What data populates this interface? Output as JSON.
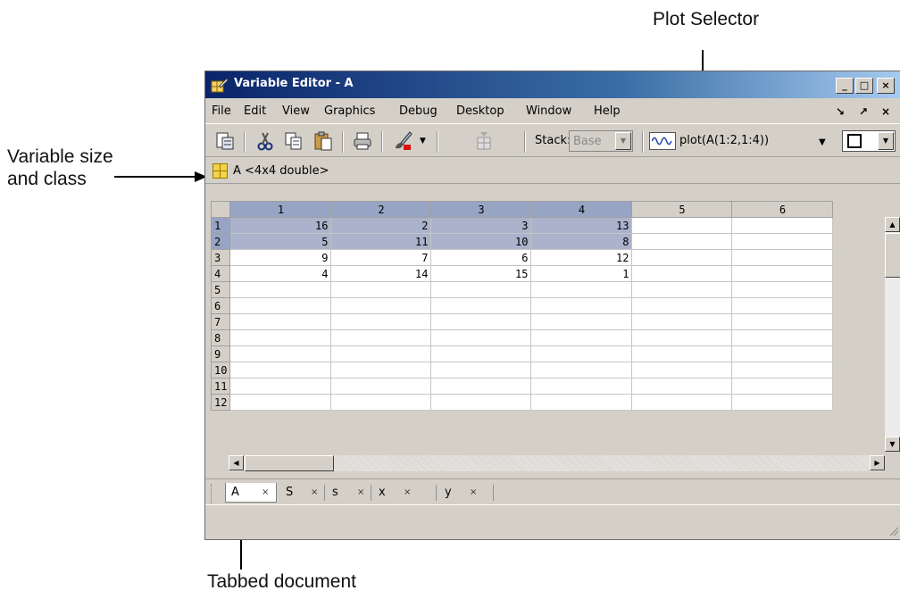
{
  "callouts": {
    "plot_selector": "Plot Selector",
    "variable_line1": "Variable size",
    "variable_line2": "and class",
    "tabbed_document": "Tabbed document"
  },
  "window": {
    "title": "Variable Editor - A",
    "controls": {
      "minimize": "_",
      "maximize": "□",
      "close": "×"
    }
  },
  "menu": {
    "items": [
      "File",
      "Edit",
      "View",
      "Graphics",
      "Debug",
      "Desktop",
      "Window",
      "Help"
    ],
    "dock": "↘",
    "undock": "↗",
    "close": "×"
  },
  "toolbar": {
    "icons": [
      "import-data-icon",
      "cut-icon",
      "copy-icon",
      "paste-icon",
      "print-icon",
      "brush-icon",
      "dropdown-arrow-icon",
      "variable-new-icon"
    ],
    "stack_label": "Stack:",
    "stack_value": "Base",
    "plot_command": "plot(A(1:2,1:4))"
  },
  "info": {
    "variable_summary": "A <4x4 double>"
  },
  "sheet": {
    "columns": [
      "1",
      "2",
      "3",
      "4",
      "5",
      "6"
    ],
    "rows": [
      {
        "label": "1",
        "cells": [
          "16",
          "2",
          "3",
          "13",
          "",
          ""
        ]
      },
      {
        "label": "2",
        "cells": [
          "5",
          "11",
          "10",
          "8",
          "",
          ""
        ]
      },
      {
        "label": "3",
        "cells": [
          "9",
          "7",
          "6",
          "12",
          "",
          ""
        ]
      },
      {
        "label": "4",
        "cells": [
          "4",
          "14",
          "15",
          "1",
          "",
          ""
        ]
      },
      {
        "label": "5",
        "cells": [
          "",
          "",
          "",
          "",
          "",
          ""
        ]
      },
      {
        "label": "6",
        "cells": [
          "",
          "",
          "",
          "",
          "",
          ""
        ]
      },
      {
        "label": "7",
        "cells": [
          "",
          "",
          "",
          "",
          "",
          ""
        ]
      },
      {
        "label": "8",
        "cells": [
          "",
          "",
          "",
          "",
          "",
          ""
        ]
      },
      {
        "label": "9",
        "cells": [
          "",
          "",
          "",
          "",
          "",
          ""
        ]
      },
      {
        "label": "10",
        "cells": [
          "",
          "",
          "",
          "",
          "",
          ""
        ]
      },
      {
        "label": "11",
        "cells": [
          "",
          "",
          "",
          "",
          "",
          ""
        ]
      },
      {
        "label": "12",
        "cells": [
          "",
          "",
          "",
          "",
          "",
          ""
        ]
      }
    ],
    "selected_rows": [
      "1",
      "2"
    ],
    "selected_columns": [
      "1",
      "2",
      "3",
      "4"
    ]
  },
  "tabs": [
    {
      "label": "A",
      "close": "×",
      "active": true
    },
    {
      "label": "S",
      "close": "×",
      "active": false
    },
    {
      "label": "s",
      "close": "×",
      "active": false
    },
    {
      "label": "x",
      "close": "×",
      "active": false
    },
    {
      "label": "y",
      "close": "×",
      "active": false
    }
  ],
  "colors": {
    "title_bar_start": "#0a246a",
    "title_bar_end": "#a6caf0",
    "selection": "#aab2cc",
    "chrome": "#d4d0c8"
  }
}
